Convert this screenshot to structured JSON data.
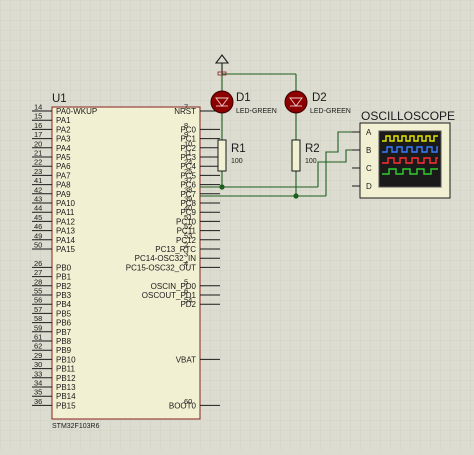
{
  "ic": {
    "ref": "U1",
    "part": "STM32F103R6",
    "left_pins": [
      {
        "num": "14",
        "name": "PA0-WKUP"
      },
      {
        "num": "15",
        "name": "PA1"
      },
      {
        "num": "16",
        "name": "PA2"
      },
      {
        "num": "17",
        "name": "PA3"
      },
      {
        "num": "20",
        "name": "PA4"
      },
      {
        "num": "21",
        "name": "PA5"
      },
      {
        "num": "22",
        "name": "PA6"
      },
      {
        "num": "23",
        "name": "PA7"
      },
      {
        "num": "41",
        "name": "PA8"
      },
      {
        "num": "42",
        "name": "PA9"
      },
      {
        "num": "43",
        "name": "PA10"
      },
      {
        "num": "44",
        "name": "PA11"
      },
      {
        "num": "45",
        "name": "PA12"
      },
      {
        "num": "46",
        "name": "PA13"
      },
      {
        "num": "49",
        "name": "PA14"
      },
      {
        "num": "50",
        "name": "PA15"
      },
      {
        "num": "",
        "name": ""
      },
      {
        "num": "26",
        "name": "PB0"
      },
      {
        "num": "27",
        "name": "PB1"
      },
      {
        "num": "28",
        "name": "PB2"
      },
      {
        "num": "55",
        "name": "PB3"
      },
      {
        "num": "56",
        "name": "PB4"
      },
      {
        "num": "57",
        "name": "PB5"
      },
      {
        "num": "58",
        "name": "PB6"
      },
      {
        "num": "59",
        "name": "PB7"
      },
      {
        "num": "61",
        "name": "PB8"
      },
      {
        "num": "62",
        "name": "PB9"
      },
      {
        "num": "29",
        "name": "PB10"
      },
      {
        "num": "30",
        "name": "PB11"
      },
      {
        "num": "33",
        "name": "PB12"
      },
      {
        "num": "34",
        "name": "PB13"
      },
      {
        "num": "35",
        "name": "PB14"
      },
      {
        "num": "36",
        "name": "PB15"
      }
    ],
    "right_pins": [
      {
        "num": "7",
        "name": "NRST"
      },
      {
        "num": "",
        "name": ""
      },
      {
        "num": "8",
        "name": "PC0"
      },
      {
        "num": "9",
        "name": "PC1"
      },
      {
        "num": "10",
        "name": "PC2"
      },
      {
        "num": "11",
        "name": "PC3"
      },
      {
        "num": "24",
        "name": "PC4"
      },
      {
        "num": "25",
        "name": "PC5"
      },
      {
        "num": "37",
        "name": "PC6"
      },
      {
        "num": "38",
        "name": "PC7"
      },
      {
        "num": "39",
        "name": "PC8"
      },
      {
        "num": "40",
        "name": "PC9"
      },
      {
        "num": "51",
        "name": "PC10"
      },
      {
        "num": "52",
        "name": "PC11"
      },
      {
        "num": "53",
        "name": "PC12"
      },
      {
        "num": "2",
        "name": "PC13_RTC"
      },
      {
        "num": "3",
        "name": "PC14-OSC32_IN"
      },
      {
        "num": "4",
        "name": "PC15-OSC32_OUT"
      },
      {
        "num": "",
        "name": ""
      },
      {
        "num": "5",
        "name": "OSCIN_PD0"
      },
      {
        "num": "6",
        "name": "OSCOUT_PD1"
      },
      {
        "num": "54",
        "name": "PD2"
      },
      {
        "num": "",
        "name": ""
      },
      {
        "num": "",
        "name": ""
      },
      {
        "num": "",
        "name": ""
      },
      {
        "num": "",
        "name": ""
      },
      {
        "num": "",
        "name": ""
      },
      {
        "num": "",
        "name": "VBAT"
      },
      {
        "num": "",
        "name": ""
      },
      {
        "num": "",
        "name": ""
      },
      {
        "num": "",
        "name": ""
      },
      {
        "num": "",
        "name": ""
      },
      {
        "num": "60",
        "name": "BOOT0"
      }
    ]
  },
  "d1": {
    "ref": "D1",
    "value": "LED-GREEN"
  },
  "d2": {
    "ref": "D2",
    "value": "LED-GREEN"
  },
  "r1": {
    "ref": "R1",
    "value": "100"
  },
  "r2": {
    "ref": "R2",
    "value": "100"
  },
  "scope": {
    "title": "OSCILLOSCOPE",
    "channels": [
      "A",
      "B",
      "C",
      "D"
    ],
    "trace_colors": [
      "#e8e800",
      "#3a7cff",
      "#ff3030",
      "#30d030"
    ]
  },
  "colors": {
    "background": "#dcdcd0",
    "grid": "#c8c8ba",
    "ic_body": "#f2f0d2",
    "wire": "#1d5e1d",
    "led_fill": "#8c0000",
    "resistor_body": "#f2f0d2",
    "scope_screen": "#1a1a1a"
  }
}
